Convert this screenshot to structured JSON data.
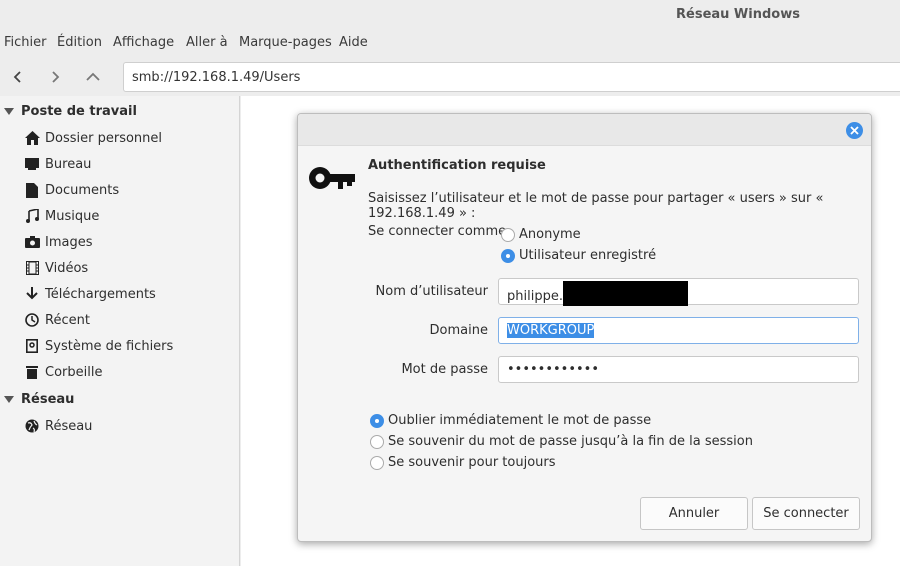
{
  "window": {
    "title": "Réseau Windows"
  },
  "menu": [
    "Fichier",
    "Édition",
    "Affichage",
    "Aller à",
    "Marque-pages",
    "Aide"
  ],
  "address": {
    "path": "smb://192.168.1.49/Users"
  },
  "sidebar": {
    "section1": "Poste de travail",
    "items": [
      {
        "label": "Dossier personnel",
        "icon": "home-icon"
      },
      {
        "label": "Bureau",
        "icon": "desktop-icon"
      },
      {
        "label": "Documents",
        "icon": "document-icon"
      },
      {
        "label": "Musique",
        "icon": "music-icon"
      },
      {
        "label": "Images",
        "icon": "camera-icon"
      },
      {
        "label": "Vidéos",
        "icon": "film-icon"
      },
      {
        "label": "Téléchargements",
        "icon": "download-icon"
      },
      {
        "label": "Récent",
        "icon": "clock-icon"
      },
      {
        "label": "Système de fichiers",
        "icon": "drive-icon"
      },
      {
        "label": "Corbeille",
        "icon": "trash-icon"
      }
    ],
    "section2": "Réseau",
    "network_items": [
      {
        "label": "Réseau",
        "icon": "globe-icon"
      }
    ]
  },
  "dialog": {
    "title": "Authentification requise",
    "message": "Saisissez l’utilisateur et le mot de passe pour partager « users » sur « 192.168.1.49 » :",
    "connect_as_label": "Se connecter comme",
    "anon_label": "Anonyme",
    "registered_label": "Utilisateur enregistré",
    "username_label": "Nom d’utilisateur",
    "username_value": "philippe.",
    "domain_label": "Domaine",
    "domain_value": "WORKGROUP",
    "password_label": "Mot de passe",
    "password_value": "••••••••••••",
    "remember_options": [
      "Oublier immédiatement le mot de passe",
      "Se souvenir du mot de passe jusqu’à la fin de la session",
      "Se souvenir pour toujours"
    ],
    "cancel_label": "Annuler",
    "connect_label": "Se connecter"
  },
  "colors": {
    "accent": "#3d8ee6"
  }
}
